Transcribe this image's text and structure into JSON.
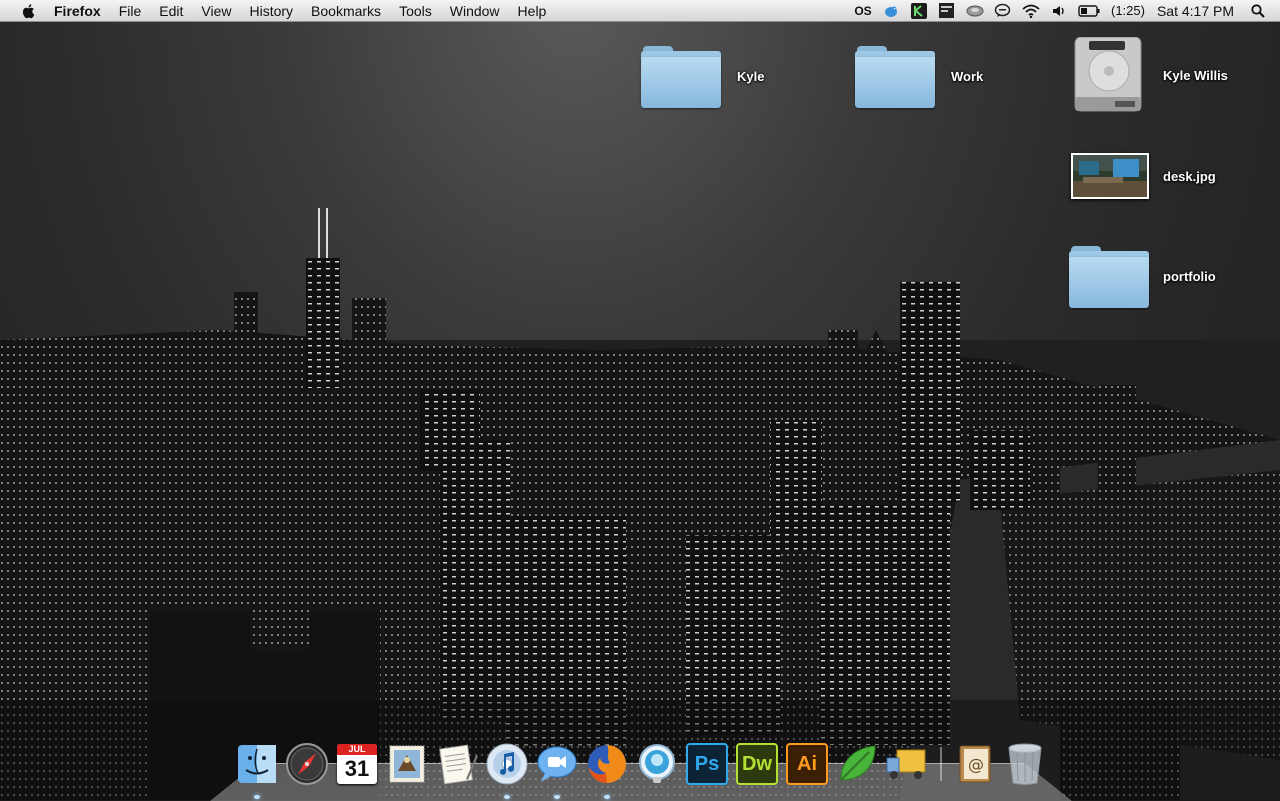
{
  "menubar": {
    "app_name": "Firefox",
    "menus": [
      "File",
      "Edit",
      "View",
      "History",
      "Bookmarks",
      "Tools",
      "Window",
      "Help"
    ],
    "status": {
      "lastfm": "OS",
      "battery_time": "(1:25)",
      "clock": "Sat 4:17 PM"
    }
  },
  "desktop": {
    "icons": {
      "kyle": "Kyle",
      "work": "Work",
      "hdd": "Kyle Willis",
      "desk": "desk.jpg",
      "portfolio": "portfolio"
    }
  },
  "dock": {
    "calendar_month": "JUL",
    "calendar_day": "31",
    "ps": "Ps",
    "dw": "Dw",
    "ai": "Ai"
  },
  "colors": {
    "folder": "#9fc9e6",
    "ps_bg": "#0d2336",
    "ps_fg": "#2ea9ee",
    "dw_bg": "#2c3a0e",
    "dw_fg": "#b4e033",
    "ai_bg": "#3b1f02",
    "ai_fg": "#ff9a1f"
  }
}
